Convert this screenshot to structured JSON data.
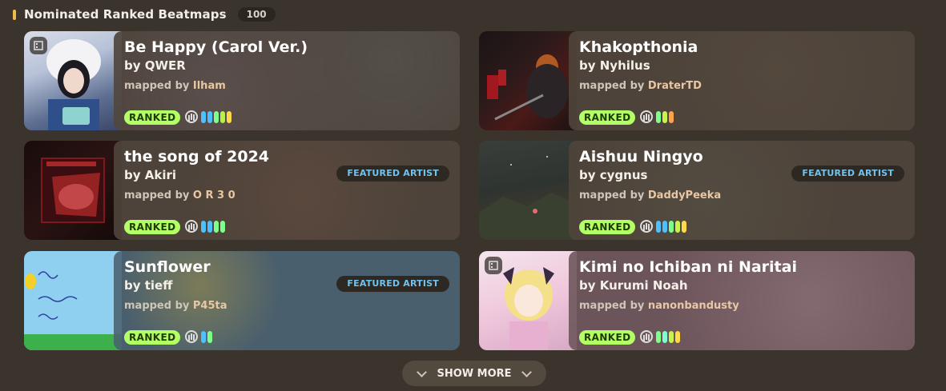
{
  "section": {
    "title": "Nominated Ranked Beatmaps",
    "count": "100"
  },
  "labels": {
    "by": "by",
    "mapped_by": "mapped by"
  },
  "cards": [
    {
      "title": "Be Happy (Carol Ver.)",
      "artist": "by QWER",
      "mapper_prefix": "mapped by",
      "mapper": "Ilham",
      "status": "RANKED",
      "featured": "",
      "video": true,
      "difficulty_colors": [
        "#4fc0ff",
        "#4fc0ff",
        "#7dff8a",
        "#b6f24a",
        "#ffd94a"
      ]
    },
    {
      "title": "Khakopthonia",
      "artist": "by Nyhilus",
      "mapper_prefix": "mapped by",
      "mapper": "DraterTD",
      "status": "RANKED",
      "featured": "",
      "video": false,
      "difficulty_colors": [
        "#7dff8a",
        "#c9f24a",
        "#ffa34a"
      ]
    },
    {
      "title": "the song of 2024",
      "artist": "by Akiri",
      "mapper_prefix": "mapped by",
      "mapper": "O R 3 0",
      "status": "RANKED",
      "featured": "FEATURED ARTIST",
      "video": false,
      "difficulty_colors": [
        "#4fc0ff",
        "#4fc0ff",
        "#7dff8a",
        "#7dff8a"
      ]
    },
    {
      "title": "Aishuu Ningyo",
      "artist": "by cygnus",
      "mapper_prefix": "mapped by",
      "mapper": "DaddyPeeka",
      "status": "RANKED",
      "featured": "FEATURED ARTIST",
      "video": false,
      "difficulty_colors": [
        "#4fc0ff",
        "#4fc0ff",
        "#7dff8a",
        "#c9f24a",
        "#ffd94a"
      ]
    },
    {
      "title": "Sunflower",
      "artist": "by tieff",
      "mapper_prefix": "mapped by",
      "mapper": "P45ta",
      "status": "RANKED",
      "featured": "FEATURED ARTIST",
      "video": false,
      "difficulty_colors": [
        "#4fc0ff",
        "#7dff8a"
      ]
    },
    {
      "title": "Kimi no Ichiban ni Naritai",
      "artist": "by Kurumi Noah",
      "mapper_prefix": "mapped by",
      "mapper": "nanonbandusty",
      "status": "RANKED",
      "featured": "",
      "video": true,
      "difficulty_colors": [
        "#7dff8a",
        "#7dffd0",
        "#c9f24a",
        "#ffd94a"
      ]
    }
  ],
  "show_more": {
    "label": "SHOW MORE"
  },
  "colors": {
    "accent": "#f0b94a",
    "ranked": "#b3ff66",
    "featured_text": "#6fc3f0",
    "background": "#3b342c"
  }
}
